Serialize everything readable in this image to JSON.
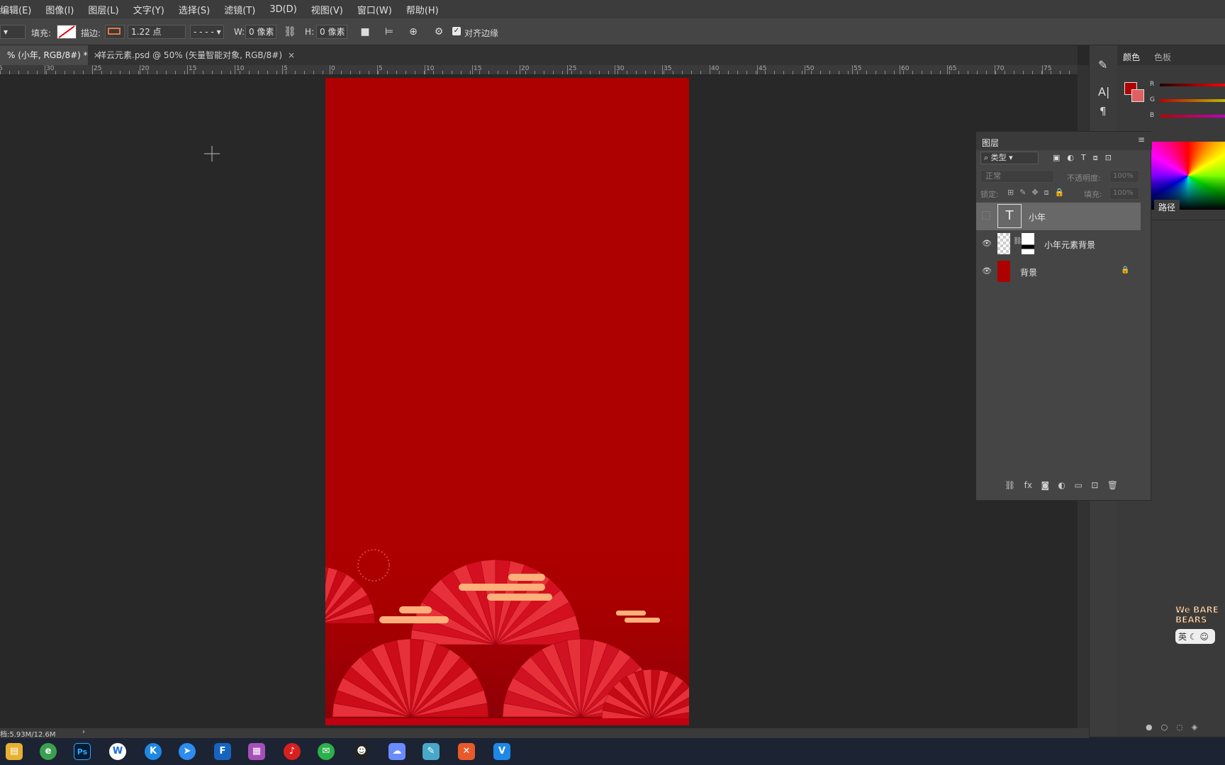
{
  "menu": [
    "编辑(E)",
    "图像(I)",
    "图层(L)",
    "文字(Y)",
    "选择(S)",
    "滤镜(T)",
    "3D(D)",
    "视图(V)",
    "窗口(W)",
    "帮助(H)"
  ],
  "options": {
    "fill_label": "填充:",
    "stroke_label": "描边:",
    "stroke_width": "1.22 点",
    "w_label": "W:",
    "w_value": "0 像素",
    "h_label": "H:",
    "h_value": "0 像素",
    "align_edges_label": "对齐边缘"
  },
  "tabs": [
    {
      "label": "% (小年, RGB/8#) *",
      "active": true
    },
    {
      "label": "祥云元素.psd @ 50% (矢量智能对象, RGB/8#)",
      "active": false
    }
  ],
  "ruler_left": [
    "5",
    "30",
    "25",
    "20",
    "15",
    "10",
    "5"
  ],
  "ruler_right": [
    "0",
    "5",
    "10",
    "15",
    "20",
    "25",
    "30",
    "35",
    "40",
    "45",
    "50",
    "55",
    "60",
    "65",
    "70",
    "75"
  ],
  "color_panel": {
    "tab_color": "颜色",
    "tab_swatches": "色板",
    "channels": [
      "R",
      "G",
      "B"
    ],
    "fg_color": "#b00000",
    "paths_tab": "路径"
  },
  "layers": {
    "title": "图层",
    "filter_kind": "类型",
    "blend_mode": "正常",
    "opacity_label": "不透明度:",
    "opacity_value": "100%",
    "lock_label": "锁定:",
    "fill_label": "填充:",
    "fill_value": "100%",
    "items": [
      {
        "name": "小年",
        "kind": "text",
        "visible": false,
        "selected": true
      },
      {
        "name": "小年元素背景",
        "kind": "smart-object-mask",
        "visible": true,
        "selected": false
      },
      {
        "name": "背景",
        "kind": "background",
        "visible": true,
        "selected": false,
        "locked": true
      }
    ]
  },
  "status": {
    "doc_size": "档:5.93M/12.6M"
  },
  "artboard_color": "#ad0000",
  "taskbar_icons": [
    "file-explorer-icon",
    "browser-icon",
    "photoshop-icon",
    "wps-icon",
    "k-app-icon",
    "feishu-icon",
    "f-app-icon",
    "design-app-icon",
    "netease-music-icon",
    "wechat-icon",
    "qq-icon",
    "cloud-app-icon",
    "notes-app-icon",
    "x-app-icon",
    "vip-app-icon"
  ],
  "taskbar_labels": {
    "photoshop": "Ps",
    "wps": "W",
    "k": "K",
    "f": "F",
    "vip": "V"
  },
  "sticker_text": {
    "line1": "We BARE",
    "line2": "BEARS",
    "ime": "英"
  }
}
